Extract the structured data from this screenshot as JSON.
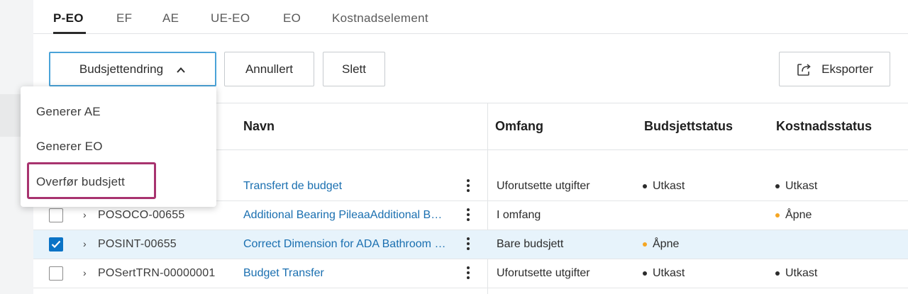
{
  "tabs": [
    {
      "label": "P-EO",
      "active": true
    },
    {
      "label": "EF",
      "active": false
    },
    {
      "label": "AE",
      "active": false
    },
    {
      "label": "UE-EO",
      "active": false
    },
    {
      "label": "EO",
      "active": false
    },
    {
      "label": "Kostnadselement",
      "active": false
    }
  ],
  "toolbar": {
    "budget_change_label": "Budsjettendring",
    "cancelled_label": "Annullert",
    "delete_label": "Slett",
    "export_label": "Eksporter",
    "export_icon": "export-icon"
  },
  "dropdown": {
    "items": [
      "Generer AE",
      "Generer EO",
      "Overfør budsjett"
    ],
    "highlighted_index": 2,
    "highlight_color": "#a8336f"
  },
  "table": {
    "columns": [
      "Navn",
      "Omfang",
      "Budsjettstatus",
      "Kostnadsstatus"
    ],
    "rows": [
      {
        "id": "",
        "name": "Transfert de budget",
        "scope": "Uforutsette utgifter",
        "budget_status": "Utkast",
        "cost_status": "Utkast",
        "checked": false
      },
      {
        "id": "POSOCO-00655",
        "name": "Additional Bearing PileaaAdditional Bearing Pileaa",
        "scope": "I omfang",
        "budget_status": "",
        "cost_status": "Åpne",
        "checked": false
      },
      {
        "id": "POSINT-00655",
        "name": "Correct Dimension for ADA Bathroom Clearance",
        "scope": "Bare budsjett",
        "budget_status": "Åpne",
        "cost_status": "",
        "checked": true
      },
      {
        "id": "POSertTRN-00000001",
        "name": "Budget Transfer",
        "scope": "Uforutsette utgifter",
        "budget_status": "Utkast",
        "cost_status": "Utkast",
        "checked": false
      }
    ]
  },
  "colors": {
    "accent": "#0a73c6",
    "link": "#1a6fb0",
    "status_draft": "#2c2c2c",
    "status_open": "#f5a623",
    "selected_row": "#e7f3fb"
  }
}
